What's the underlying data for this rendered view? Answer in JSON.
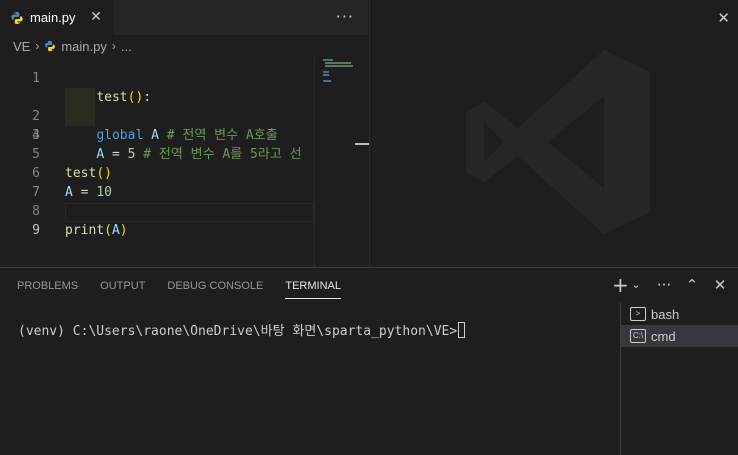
{
  "editor": {
    "tab": {
      "label": "main.py",
      "close_glyph": "✕"
    },
    "more_actions_glyph": "···",
    "breadcrumb": {
      "folder": "VE",
      "file": "main.py",
      "symbol": "..."
    },
    "lines": [
      {
        "number": "1",
        "text": "def test():"
      },
      {
        "number": "2",
        "text": "    global A # 전역 변수 A호출"
      },
      {
        "number": "3",
        "text": "    A = 5 # 전역 변수 A를 5라고 선"
      },
      {
        "number": "4",
        "text": ""
      },
      {
        "number": "5",
        "text": "test()"
      },
      {
        "number": "6",
        "text": "A = 10"
      },
      {
        "number": "7",
        "text": ""
      },
      {
        "number": "8",
        "text": "print(A)"
      },
      {
        "number": "9",
        "text": ""
      }
    ]
  },
  "empty_group": {
    "close_glyph": "✕"
  },
  "panel": {
    "tabs": [
      {
        "label": "PROBLEMS"
      },
      {
        "label": "OUTPUT"
      },
      {
        "label": "DEBUG CONSOLE"
      },
      {
        "label": "TERMINAL",
        "active": true
      }
    ],
    "actions": {
      "new_terminal": "+",
      "dropdown": "⌄",
      "more": "···",
      "maximize": "⌃",
      "close": "✕"
    },
    "terminal_prompt": "(venv) C:\\Users\\raone\\OneDrive\\바탕 화면\\sparta_python\\VE>",
    "terminals": [
      {
        "label": "bash",
        "icon": "terminal-bash-icon"
      },
      {
        "label": "cmd",
        "icon": "terminal-cmd-icon",
        "selected": true
      }
    ]
  },
  "colors": {
    "background": "#1e1e1e",
    "keyword": "#569cd6",
    "function": "#dcdcaa",
    "variable": "#9cdcfe",
    "number": "#b5cea8",
    "comment": "#6a9955"
  }
}
